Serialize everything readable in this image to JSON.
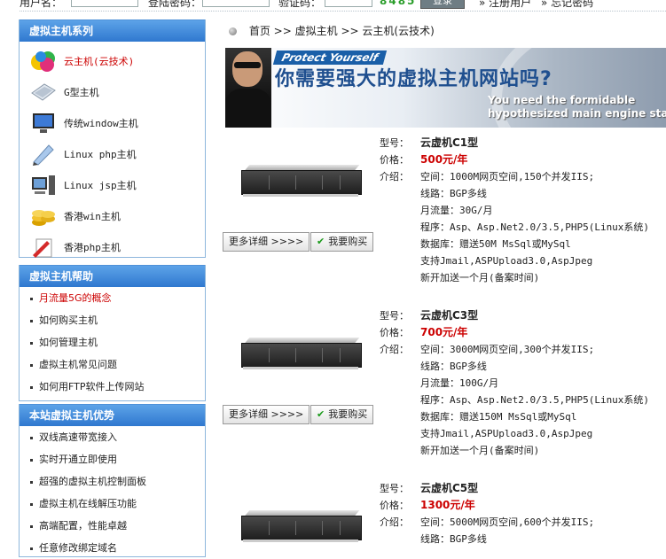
{
  "topbar": {
    "user_label": "用户名：",
    "pass_label": "登陆密码：",
    "code_label": "验证码：",
    "code_value": "8485",
    "login_button": "登录",
    "register_link": "注册用户",
    "forgot_link": "忘记密码"
  },
  "sidebar": {
    "products_title": "虚拟主机系列",
    "products": [
      {
        "label": "云主机(云技术)"
      },
      {
        "label": "G型主机"
      },
      {
        "label": "传统window主机"
      },
      {
        "label": "Linux php主机"
      },
      {
        "label": "Linux jsp主机"
      },
      {
        "label": "香港win主机"
      },
      {
        "label": "香港php主机"
      }
    ],
    "help_title": "虚拟主机帮助",
    "help": [
      {
        "label": "月流量5G的概念"
      },
      {
        "label": "如何购买主机"
      },
      {
        "label": "如何管理主机"
      },
      {
        "label": "虚拟主机常见问题"
      },
      {
        "label": "如何用FTP软件上传网站"
      }
    ],
    "adv_title": "本站虚拟主机优势",
    "advantages": [
      {
        "label": "双线高速带宽接入"
      },
      {
        "label": "实时开通立即使用"
      },
      {
        "label": "超强的虚拟主机控制面板"
      },
      {
        "label": "虚拟主机在线解压功能"
      },
      {
        "label": "高端配置，性能卓越"
      },
      {
        "label": "任意修改绑定域名"
      }
    ]
  },
  "breadcrumb": {
    "home": "首页",
    "sep": ">>",
    "level1": "虚拟主机",
    "level2": "云主机(云技术)"
  },
  "banner": {
    "tag": "Protect Yourself",
    "headline": "你需要强大的虚拟主机网站吗?",
    "en_line1": "You need the formidable",
    "en_line2": "hypothesized main engine stand"
  },
  "labels": {
    "model": "型号：",
    "price": "价格：",
    "intro": "介绍：",
    "more": "更多详细 >>>>",
    "buy": "我要购买"
  },
  "products": [
    {
      "model": "云虚机C1型",
      "price": "500元/年",
      "features": [
        "空间：1000M网页空间,150个并发IIS;",
        "线路：BGP多线",
        "月流量：30G/月",
        "程序：Asp、Asp.Net2.0/3.5,PHP5(Linux系统)",
        "数据库：赠送50M MsSql或MySql",
        "支持Jmail,ASPUpload3.0,AspJpeg",
        "新开加送一个月(备案时间)"
      ]
    },
    {
      "model": "云虚机C3型",
      "price": "700元/年",
      "features": [
        "空间：3000M网页空间,300个并发IIS;",
        "线路：BGP多线",
        "月流量：100G/月",
        "程序：Asp、Asp.Net2.0/3.5,PHP5(Linux系统)",
        "数据库：赠送150M MsSql或MySql",
        "支持Jmail,ASPUpload3.0,AspJpeg",
        "新开加送一个月(备案时间)"
      ]
    },
    {
      "model": "云虚机C5型",
      "price": "1300元/年",
      "features": [
        "空间：5000M网页空间,600个并发IIS;",
        "线路：BGP多线"
      ]
    }
  ]
}
